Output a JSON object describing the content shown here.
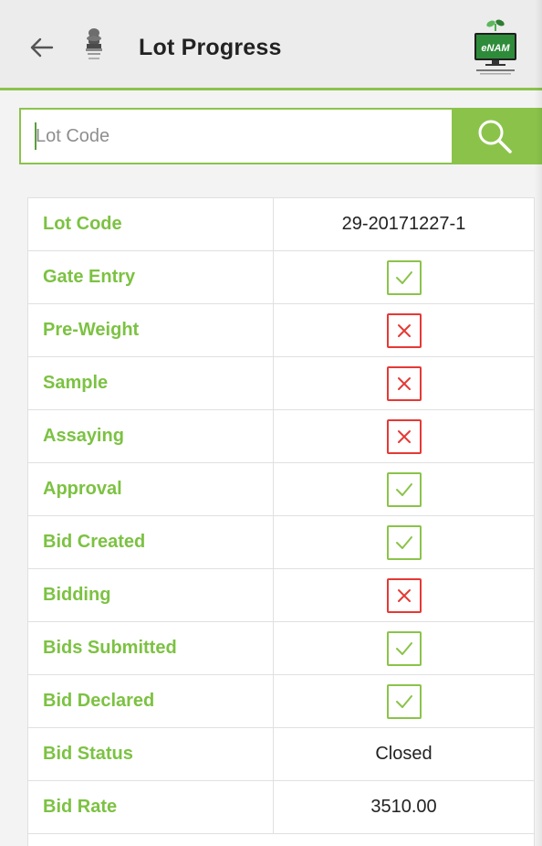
{
  "header": {
    "title": "Lot Progress",
    "back_icon": "arrow-left-icon",
    "emblem_icon": "national-emblem-icon",
    "logo_text": "eNAM"
  },
  "search": {
    "placeholder": "Lot Code",
    "value": "",
    "button_icon": "search-icon"
  },
  "colors": {
    "accent": "#8bc34a",
    "label_green": "#7cc242",
    "cross_red": "#e53935",
    "appbar_bg": "#ececec"
  },
  "rows": [
    {
      "label": "Lot Code",
      "type": "text",
      "value": "29-20171227-1"
    },
    {
      "label": "Gate Entry",
      "type": "status",
      "status": "done"
    },
    {
      "label": "Pre-Weight",
      "type": "status",
      "status": "pending"
    },
    {
      "label": "Sample",
      "type": "status",
      "status": "pending"
    },
    {
      "label": "Assaying",
      "type": "status",
      "status": "pending"
    },
    {
      "label": "Approval",
      "type": "status",
      "status": "done"
    },
    {
      "label": "Bid Created",
      "type": "status",
      "status": "done"
    },
    {
      "label": "Bidding",
      "type": "status",
      "status": "pending"
    },
    {
      "label": "Bids Submitted",
      "type": "status",
      "status": "done"
    },
    {
      "label": "Bid Declared",
      "type": "status",
      "status": "done"
    },
    {
      "label": "Bid Status",
      "type": "text",
      "value": "Closed"
    },
    {
      "label": "Bid Rate",
      "type": "text",
      "value": "3510.00"
    }
  ]
}
